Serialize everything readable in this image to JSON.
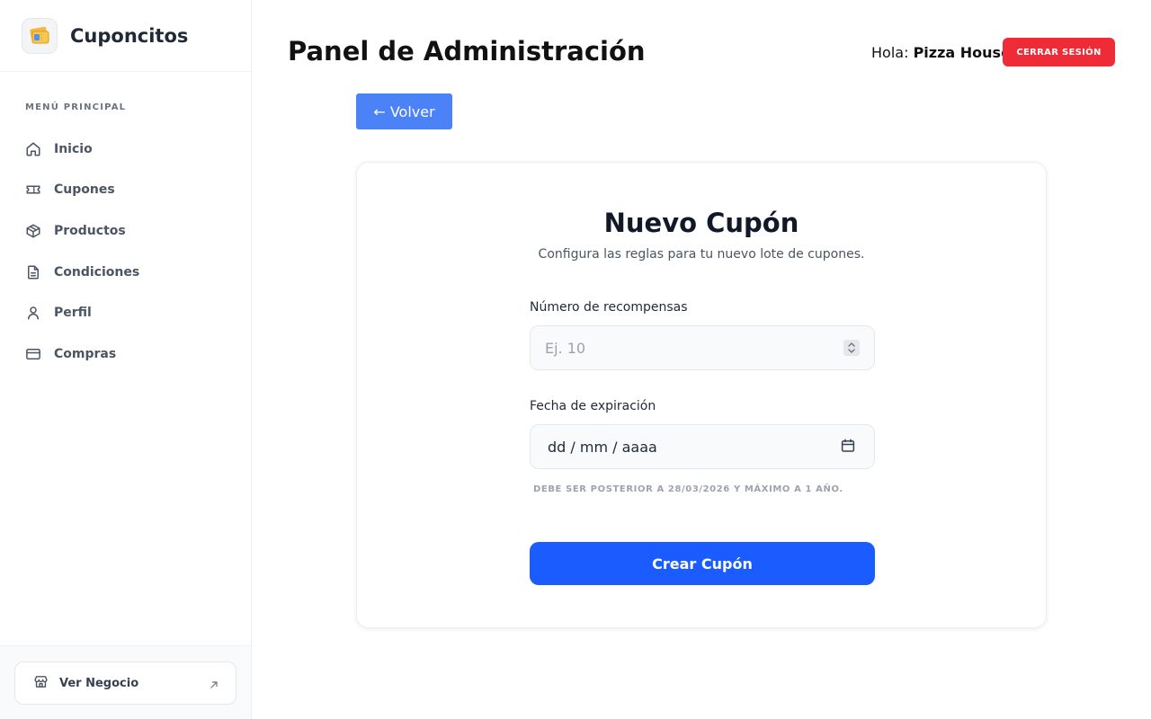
{
  "brand": {
    "name": "Cuponcitos"
  },
  "sidebar": {
    "section_title": "MENÚ PRINCIPAL",
    "items": [
      {
        "label": "Inicio",
        "icon": "home-icon"
      },
      {
        "label": "Cupones",
        "icon": "ticket-icon"
      },
      {
        "label": "Productos",
        "icon": "box-icon"
      },
      {
        "label": "Condiciones",
        "icon": "document-icon"
      },
      {
        "label": "Perfil",
        "icon": "user-icon"
      },
      {
        "label": "Compras",
        "icon": "credit-card-icon"
      }
    ],
    "footer": {
      "label": "Ver Negocio",
      "icon": "store-icon",
      "arrow_icon": "external-arrow-icon"
    }
  },
  "header": {
    "title": "Panel de Administración",
    "greeting_prefix": "Hola:",
    "user_name": "Pizza House",
    "logout_label": "CERRAR SESIÓN"
  },
  "back_button": {
    "label": "← Volver"
  },
  "form": {
    "title": "Nuevo Cupón",
    "subtitle": "Configura las reglas para tu nuevo lote de cupones.",
    "rewards_label": "Número de recompensas",
    "rewards_placeholder": "Ej. 10",
    "rewards_value": "",
    "date_label": "Fecha de expiración",
    "date_placeholder": "dd / mm / aaaa",
    "date_hint": "DEBE SER POSTERIOR A 28/03/2026 Y MÁXIMO A 1 AÑO.",
    "submit_label": "Crear Cupón"
  },
  "colors": {
    "logout": "#ef2b38",
    "back_button": "#4c82f7",
    "submit": "#1a5cff"
  }
}
